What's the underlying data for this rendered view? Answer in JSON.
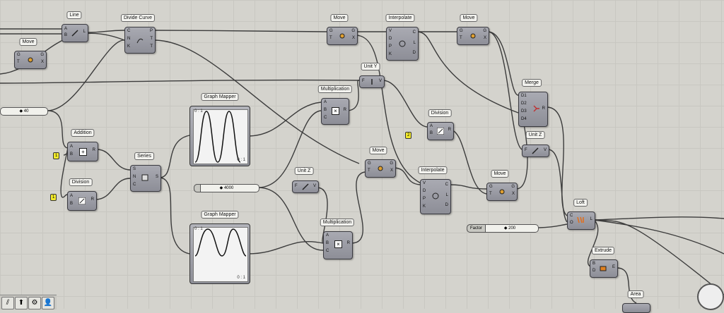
{
  "titles": {
    "line": "Line",
    "move1": "Move",
    "divide_curve": "Divide Curve",
    "move2": "Move",
    "interpolate1": "Interpolate",
    "move3": "Move",
    "unit_y": "Unit Y",
    "merge": "Merge",
    "multiplication1": "Multiplication",
    "graph_mapper1": "Graph Mapper",
    "addition": "Addition",
    "division1": "Division",
    "series": "Series",
    "division2": "Division",
    "unit_z1": "Unit Z",
    "move4": "Move",
    "interpolate2": "Interpolate",
    "move5": "Move",
    "unit_z2": "Unit Z",
    "graph_mapper2": "Graph Mapper",
    "multiplication2": "Multiplication",
    "loft": "Loft",
    "extrude": "Extrude",
    "area": "Area"
  },
  "values": {
    "slider_40": "◆ 40",
    "slider_4000": "◆ 4000",
    "slider_factor_label": "Factor",
    "slider_factor_val": "◆ 200",
    "panel_1a": "1",
    "panel_1b": "1",
    "panel_2": "2",
    "gm_corner": "0 : 1"
  },
  "ports": {
    "A": "A",
    "B": "B",
    "C": "C",
    "D": "D",
    "E": "E",
    "F": "F",
    "G": "G",
    "K": "K",
    "L": "L",
    "N": "N",
    "O": "O",
    "P": "P",
    "R": "R",
    "S": "S",
    "T": "T",
    "V": "V",
    "X": "X",
    "D1": "D1",
    "D2": "D2",
    "D3": "D3",
    "D4": "D4"
  },
  "tray": [
    "⫽",
    "⬆",
    "⚙",
    "👤"
  ]
}
